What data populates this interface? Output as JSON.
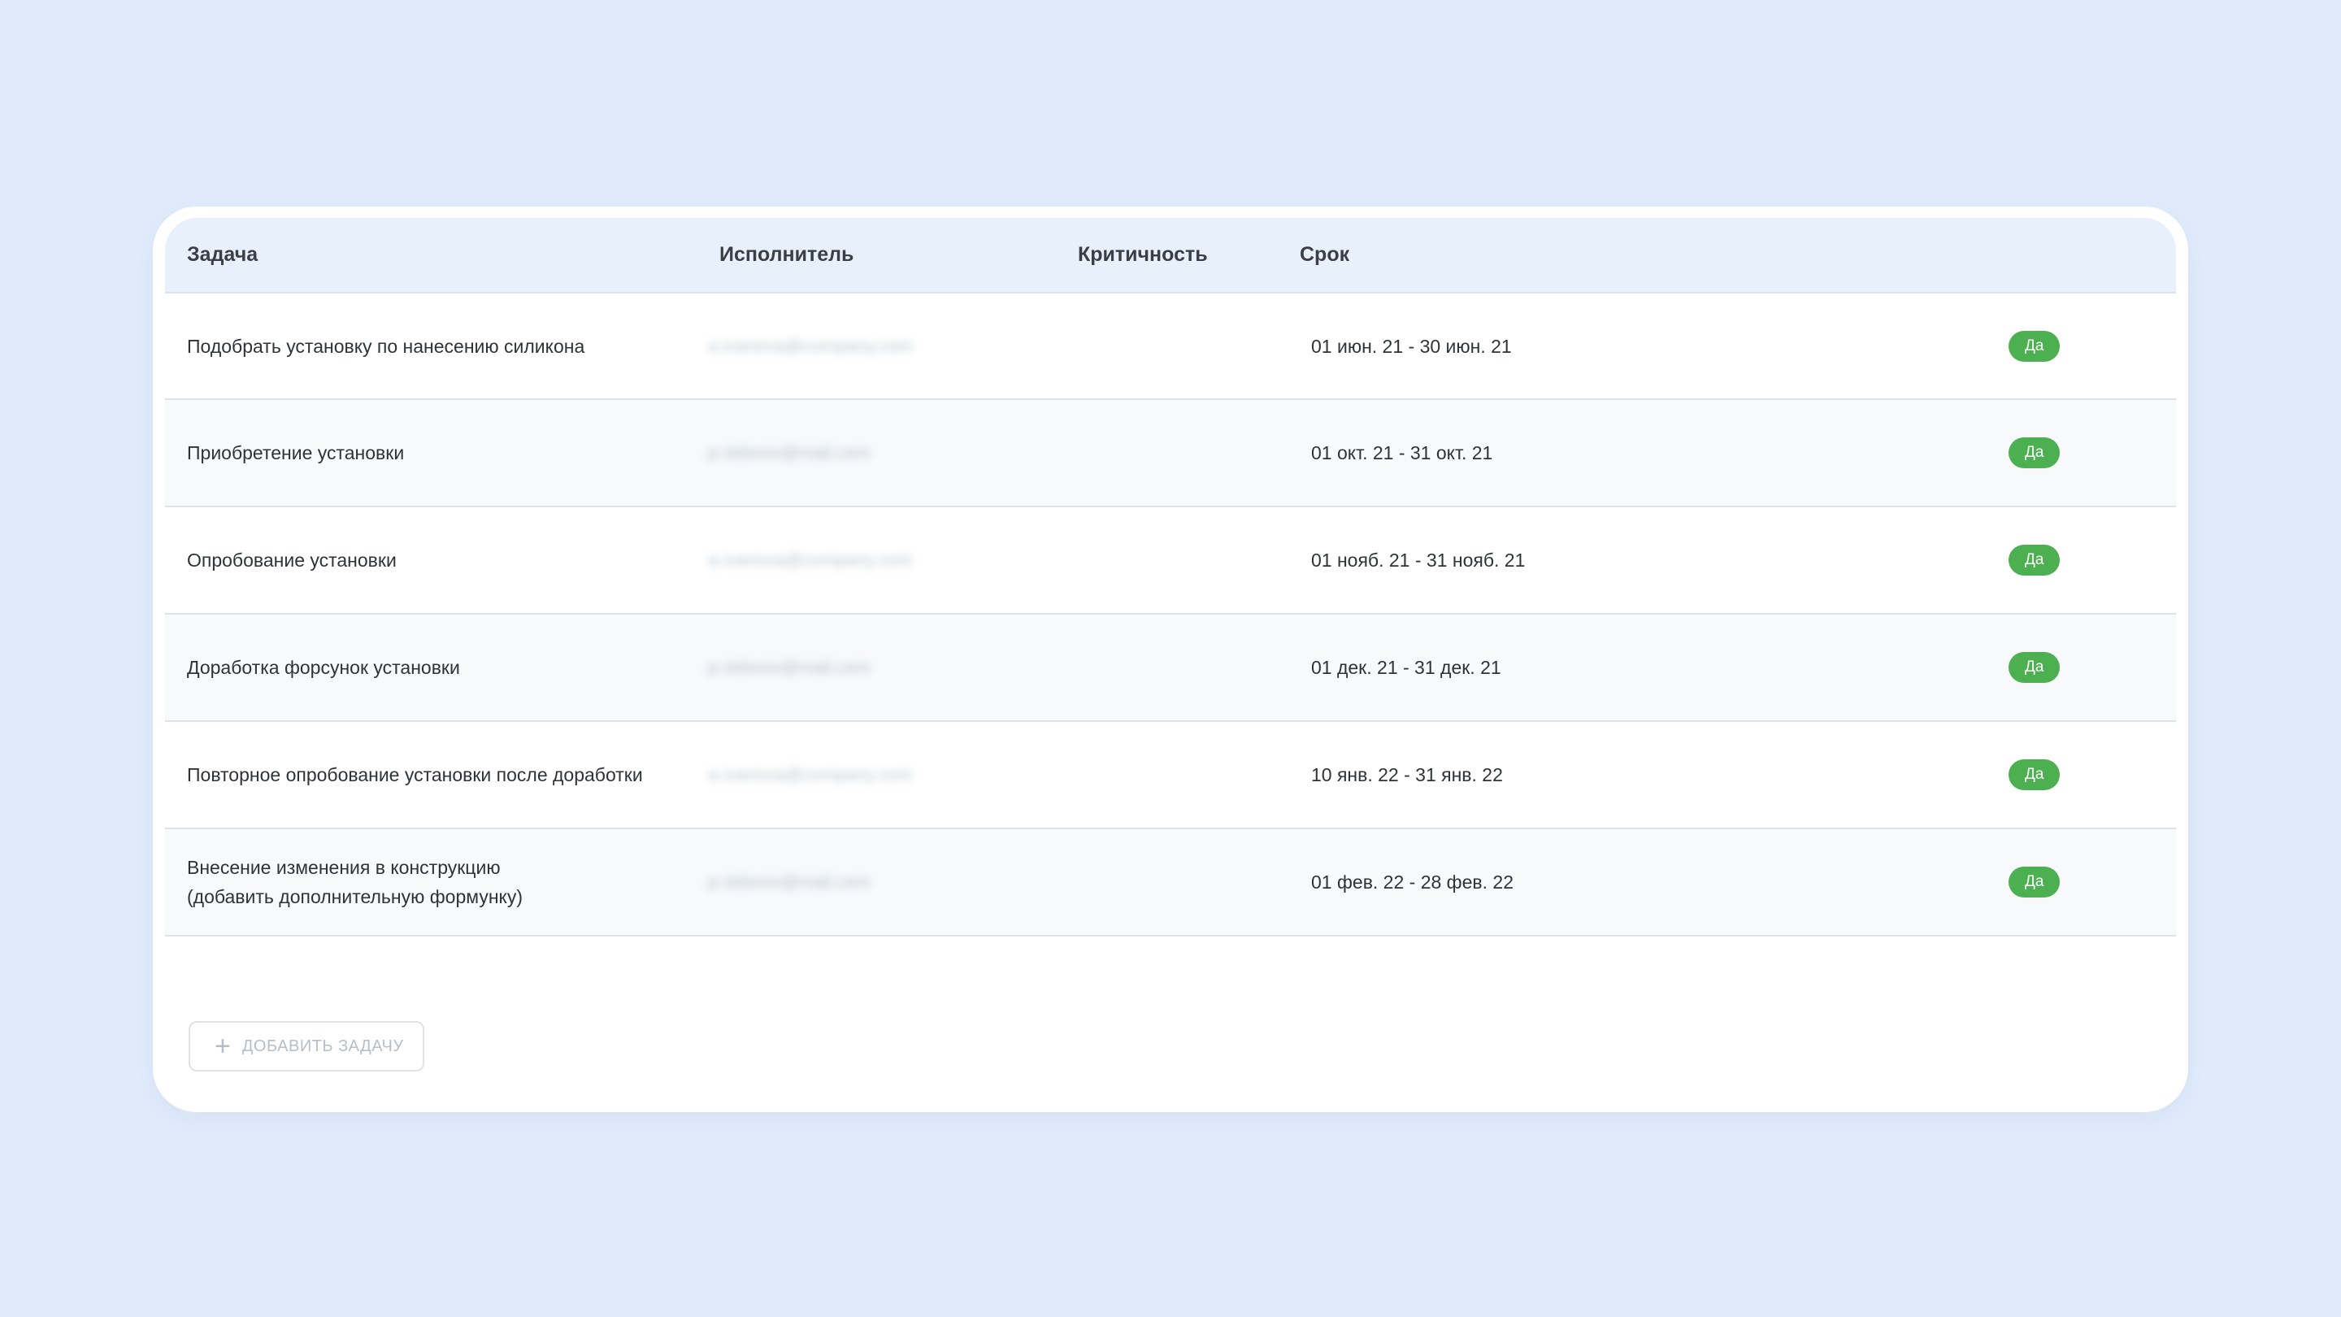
{
  "table": {
    "headers": {
      "task": "Задача",
      "assignee": "Исполнитель",
      "criticality": "Критичность",
      "deadline": "Срок"
    },
    "rows": [
      {
        "task": "Подобрать установку по нанесению силикона",
        "assignee": "a.ivanova@company.com",
        "criticality": "",
        "deadline": "01 июн. 21 - 30 июн. 21",
        "flag": "Да"
      },
      {
        "task": "Приобретение установки",
        "assignee": "p.sidorov@mail.com",
        "criticality": "",
        "deadline": "01 окт. 21 - 31 окт. 21",
        "flag": "Да"
      },
      {
        "task": "Опробование установки",
        "assignee": "a.ivanova@company.com",
        "criticality": "",
        "deadline": "01 нояб. 21 - 31 нояб. 21",
        "flag": "Да"
      },
      {
        "task": "Доработка форсунок установки",
        "assignee": "p.sidorov@mail.com",
        "criticality": "",
        "deadline": "01 дек. 21 - 31 дек. 21",
        "flag": "Да"
      },
      {
        "task": "Повторное опробование установки после доработки",
        "assignee": "a.ivanova@company.com",
        "criticality": "",
        "deadline": "10 янв. 22 - 31 янв. 22",
        "flag": "Да"
      },
      {
        "task_line1": "Внесение изменения в конструкцию",
        "task_line2": "(добавить дополнительную формунку)",
        "assignee": "p.sidorov@mail.com",
        "criticality": "",
        "deadline": "01 фев. 22 - 28 фев. 22",
        "flag": "Да"
      }
    ]
  },
  "add_button": {
    "icon": "plus-icon",
    "label": "ДОБАВИТЬ ЗАДАЧУ"
  },
  "colors": {
    "background": "#dfebfb",
    "card": "#ffffff",
    "header": "#e8f0fb",
    "badge": "#4caf50"
  }
}
